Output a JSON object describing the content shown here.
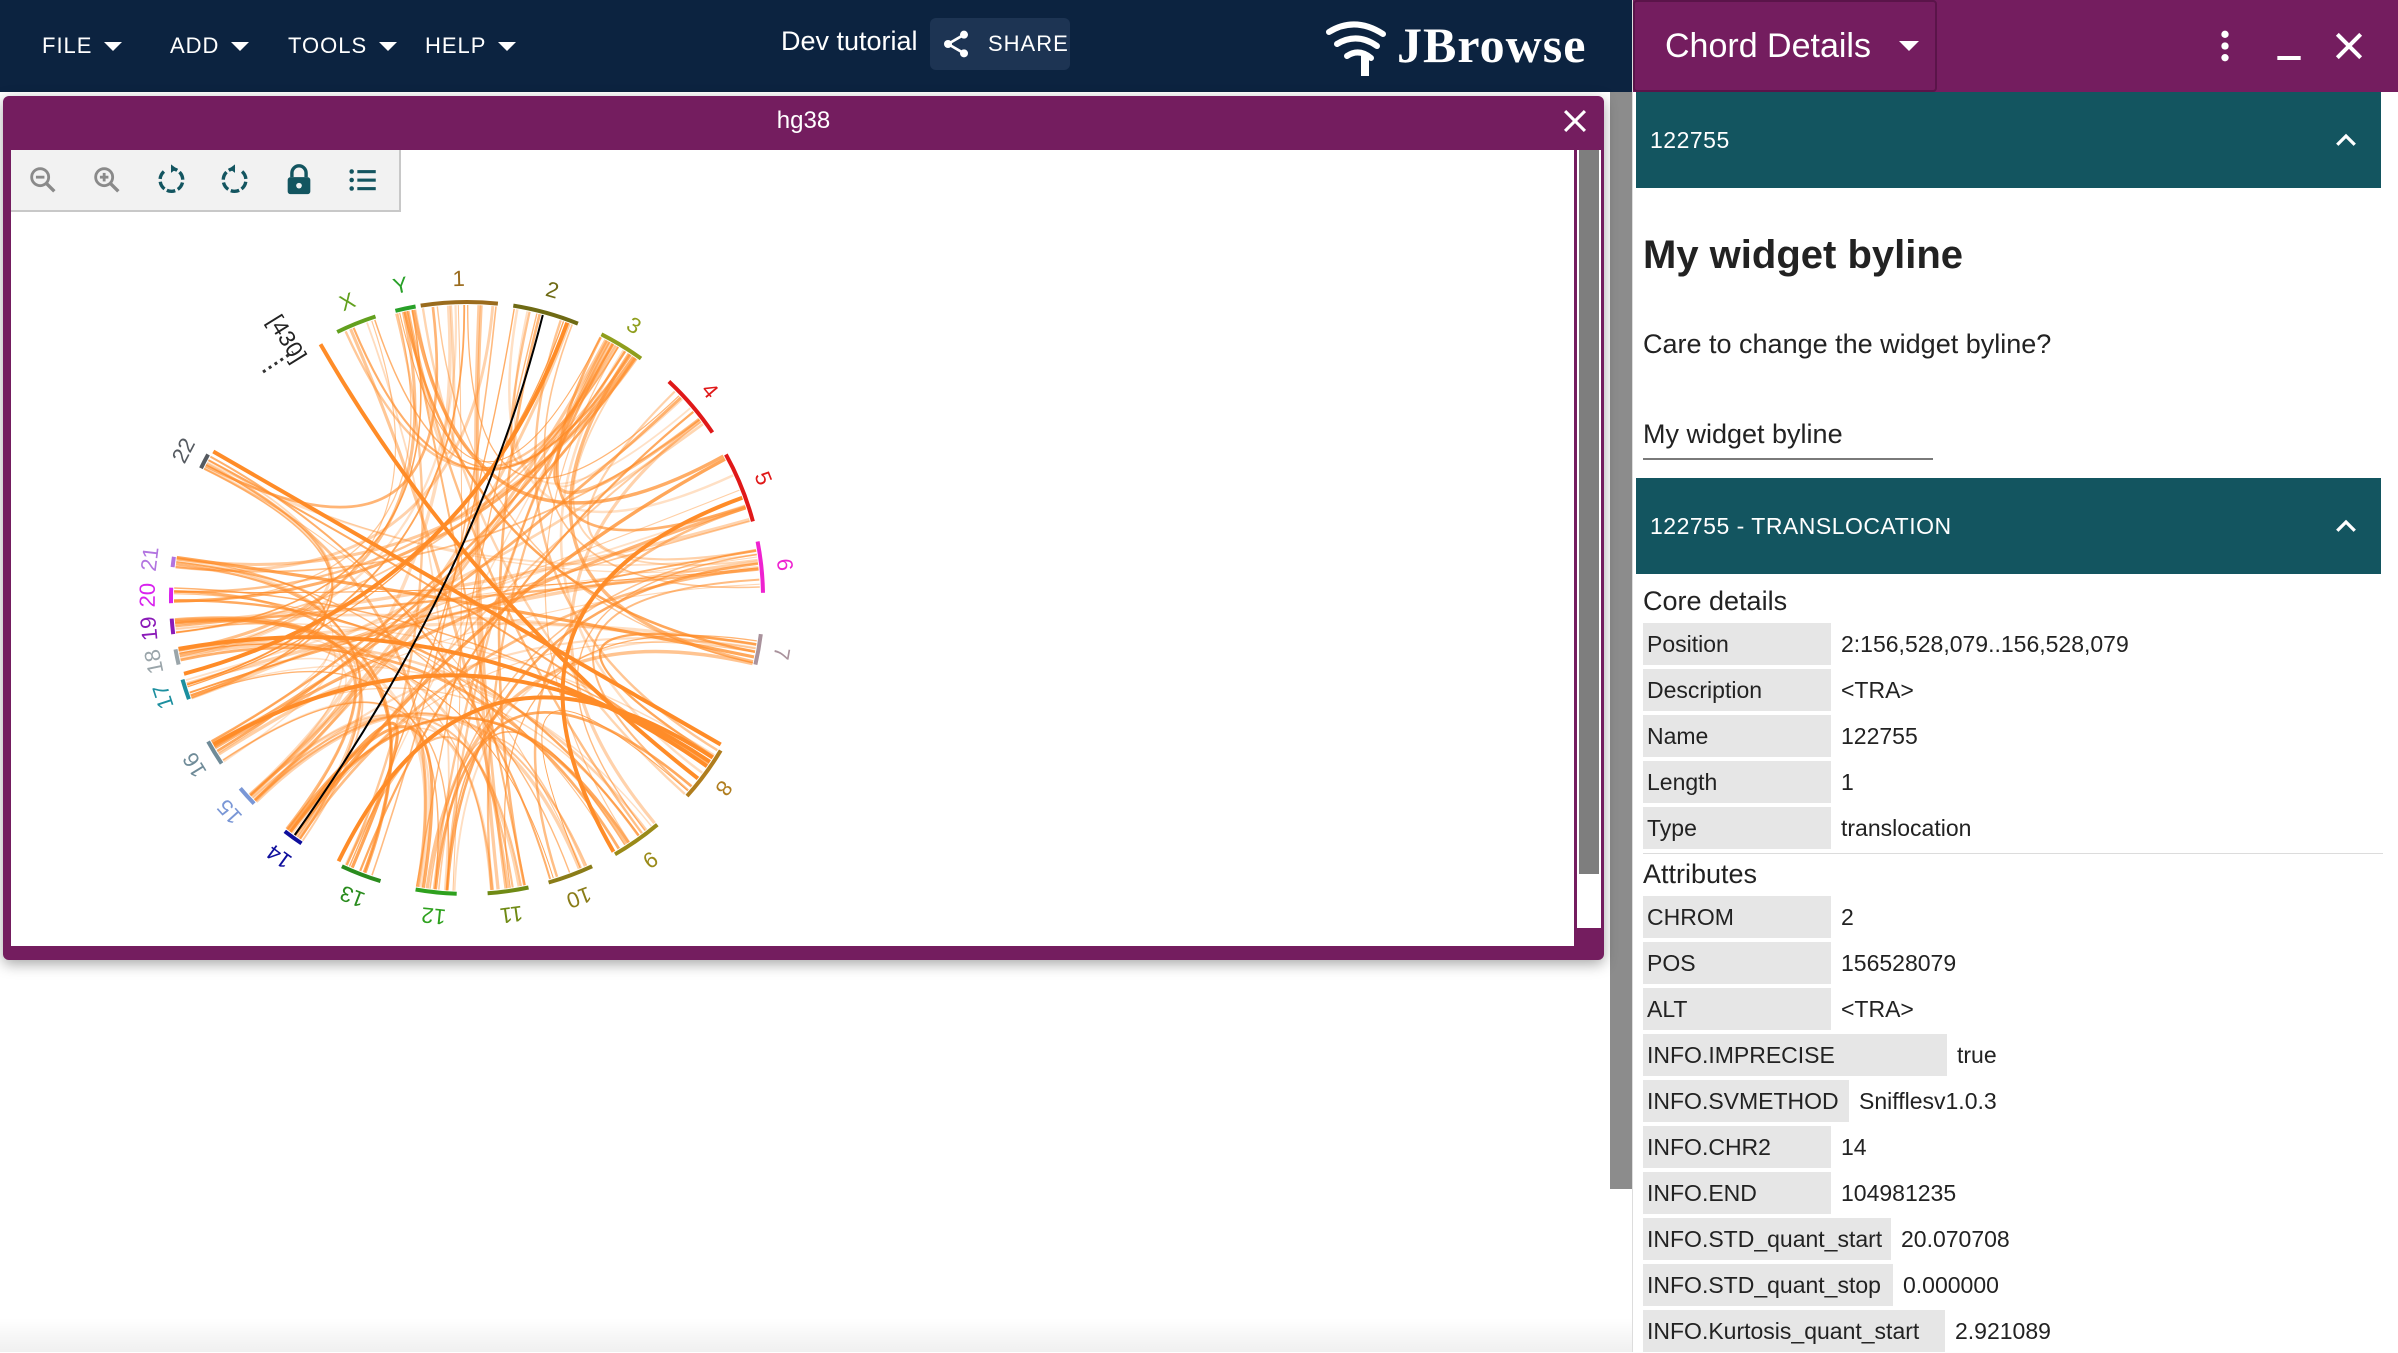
{
  "menu": {
    "file": "FILE",
    "add": "ADD",
    "tools": "TOOLS",
    "help": "HELP"
  },
  "session_name": "Dev tutorial",
  "share_label": "SHARE",
  "brand": "JBrowse",
  "colors": {
    "appbar": "#0c2340",
    "view_header": "#741d5f",
    "accordion": "#135560",
    "chord": "#ff8c28",
    "selected_chord": "#000000"
  },
  "view": {
    "title": "hg38",
    "hidden_label": "[430]"
  },
  "toolbar": {
    "icons": [
      "zoom-out-icon",
      "zoom-in-icon",
      "rotate-left-icon",
      "rotate-right-icon",
      "lock-icon",
      "list-icon"
    ]
  },
  "chromosomes": [
    {
      "name": "1",
      "color": "#9a6b1d"
    },
    {
      "name": "2",
      "color": "#6e6a14"
    },
    {
      "name": "3",
      "color": "#8f9e1d"
    },
    {
      "name": "4",
      "color": "#e01818"
    },
    {
      "name": "5",
      "color": "#e01818"
    },
    {
      "name": "6",
      "color": "#ee22d0"
    },
    {
      "name": "7",
      "color": "#a9929c"
    },
    {
      "name": "8",
      "color": "#b07d1e"
    },
    {
      "name": "9",
      "color": "#9a8a18"
    },
    {
      "name": "10",
      "color": "#8a7c18"
    },
    {
      "name": "11",
      "color": "#6f8a14"
    },
    {
      "name": "12",
      "color": "#2ea11e"
    },
    {
      "name": "13",
      "color": "#2a8c1e"
    },
    {
      "name": "14",
      "color": "#0e0e9c"
    },
    {
      "name": "15",
      "color": "#7a97d6"
    },
    {
      "name": "16",
      "color": "#6f8b98"
    },
    {
      "name": "17",
      "color": "#1c8f9f"
    },
    {
      "name": "18",
      "color": "#9aa5aa"
    },
    {
      "name": "19",
      "color": "#8a1ab8"
    },
    {
      "name": "20",
      "color": "#d822ee"
    },
    {
      "name": "21",
      "color": "#b274e0"
    },
    {
      "name": "22",
      "color": "#555a60"
    },
    {
      "name": "X",
      "color": "#62a01e"
    },
    {
      "name": "Y",
      "color": "#28a028"
    }
  ],
  "drawer": {
    "widget_name": "Chord Details",
    "panel1_title": "122755",
    "byline_title": "My widget byline",
    "byline_question": "Care to change the widget byline?",
    "byline_value": "My widget byline",
    "panel2_title": "122755 - TRANSLOCATION",
    "core_label": "Core details",
    "attributes_label": "Attributes",
    "core": [
      {
        "key": "Position",
        "value": "2:156,528,079..156,528,079"
      },
      {
        "key": "Description",
        "value": "<TRA>"
      },
      {
        "key": "Name",
        "value": "122755"
      },
      {
        "key": "Length",
        "value": "1"
      },
      {
        "key": "Type",
        "value": "translocation"
      }
    ],
    "attributes": [
      {
        "key": "CHROM",
        "value": "2"
      },
      {
        "key": "POS",
        "value": "156528079"
      },
      {
        "key": "ALT",
        "value": "<TRA>"
      },
      {
        "key": "INFO.IMPRECISE",
        "value": "true"
      },
      {
        "key": "INFO.SVMETHOD",
        "value": "Snifflesv1.0.3"
      },
      {
        "key": "INFO.CHR2",
        "value": "14"
      },
      {
        "key": "INFO.END",
        "value": "104981235"
      },
      {
        "key": "INFO.STD_quant_start",
        "value": "20.070708"
      },
      {
        "key": "INFO.STD_quant_stop",
        "value": "0.000000"
      },
      {
        "key": "INFO.Kurtosis_quant_start",
        "value": "2.921089"
      }
    ]
  }
}
